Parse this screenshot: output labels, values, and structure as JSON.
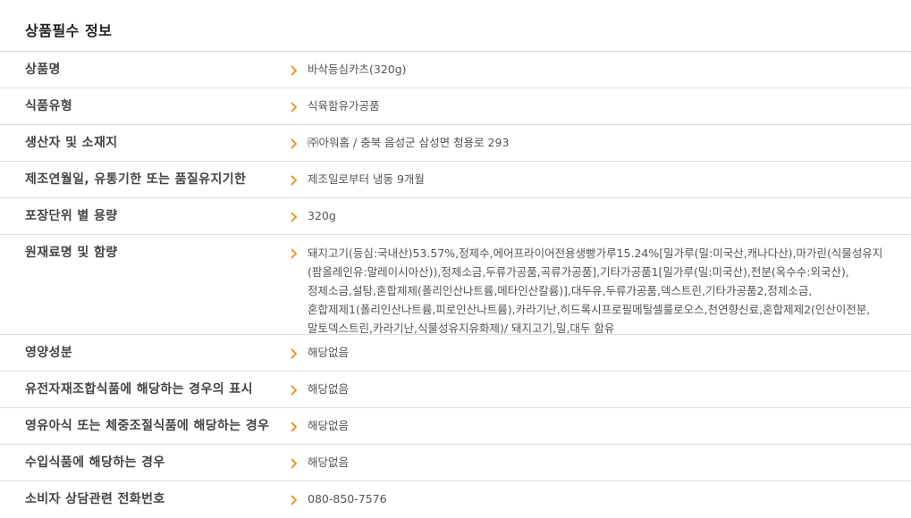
{
  "section": {
    "title": "상품필수 정보",
    "accent_color": "#e39b36"
  },
  "rows": [
    {
      "label": "상품명",
      "value": "바삭등심카츠(320g)"
    },
    {
      "label": "식품유형",
      "value": "식육함유가공품"
    },
    {
      "label": "생산자 및 소재지",
      "value": "㈜아워홈 / 충북 음성군 삼성면 청용로 293"
    },
    {
      "label": "제조연월일, 유통기한 또는 품질유지기한",
      "value": "제조일로부터 냉동 9개월"
    },
    {
      "label": "포장단위 별 용량",
      "value": "320g"
    },
    {
      "label": "원재료명 및 함량",
      "value": "돼지고기(등심:국내산)53.57%,정제수,에어프라이어전용생빵가루15.24%[밀가루(밀:미국산,캐나다산),마가린(식물성유지(팜올레인유:말레이시아산)),정제소금,두류가공품,곡류가공품],기타가공품1[밀가루(밀:미국산),전분(옥수수:외국산),정제소금,설탕,혼합제제(폴리인산나트륨,메타인산칼륨)],대두유,두류가공품,덱스트린,기타가공품2,정제소금,혼합제제1(폴리인산나트륨,피로인산나트륨),카라기난,히드록시프로필메틸셀룰로오스,천연향신료,혼합제제2(인산이전분,말토덱스트린,카라기난,식물성유지유화제)/ 돼지고기,밀,대두 함유"
    },
    {
      "label": "영양성분",
      "value": "해당없음"
    },
    {
      "label": "유전자재조합식품에 해당하는 경우의 표시",
      "value": "해당없음"
    },
    {
      "label": "영유아식 또는 체중조절식품에 해당하는 경우",
      "value": "해당없음"
    },
    {
      "label": "수입식품에 해당하는 경우",
      "value": "해당없음"
    },
    {
      "label": "소비자 상담관련 전화번호",
      "value": "080-850-7576"
    }
  ],
  "icons": {
    "row_marker": "chevron-right-icon"
  }
}
